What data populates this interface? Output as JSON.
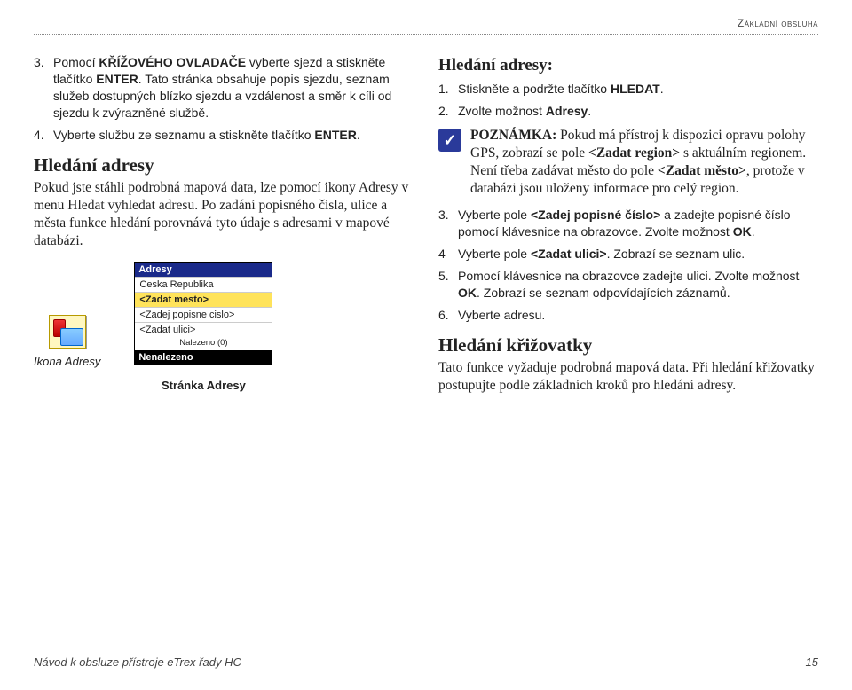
{
  "header": "Základní obsluha",
  "left": {
    "item3_num": "3.",
    "item3_txt": "Pomocí <b>KŘÍŽOVÉHO OVLADAČE</b> vyberte sjezd a stiskněte tlačítko <b>ENTER</b>. Tato stránka obsahuje popis sjezdu, seznam služeb dostupných blízko sjezdu a vzdálenost a směr k cíli od sjezdu k zvýrazněné službě.",
    "item4_num": "4.",
    "item4_txt": "Vyberte službu ze seznamu a stiskněte tlačítko <b>ENTER</b>.",
    "section_title": "Hledání adresy",
    "section_body": "Pokud jste stáhli podrobná mapová data, lze pomocí ikony Adresy v menu Hledat vyhledat adresu. Po zadání popisného čísla, ulice a města funkce hledání porovnává tyto údaje s adresami v mapové databázi.",
    "icon_caption": "Ikona Adresy",
    "screen": {
      "title": "Adresy",
      "r1": "Ceska Republika",
      "r2": "<Zadat mesto>",
      "r3": "<Zadej popisne cislo>",
      "r4": "<Zadat ulici>",
      "tiny": "Nalezeno (0)",
      "result": "Nenalezeno"
    },
    "page_caption": "Stránka Adresy"
  },
  "right": {
    "proc_title": "Hledání adresy:",
    "s1_num": "1.",
    "s1_txt": "Stiskněte a podržte tlačítko <b>HLEDAT</b>.",
    "s2_num": "2.",
    "s2_txt": "Zvolte možnost <b>Adresy</b>.",
    "note_glyph": "✓",
    "note": "<b>POZNÁMKA:</b> Pokud má přístroj k dispozici opravu polohy GPS, zobrazí se pole <b>&lt;Zadat region&gt;</b> s aktuálním regionem. Není třeba zadávat město do pole <b>&lt;Zadat město&gt;</b>, protože v databázi jsou uloženy informace pro celý region.",
    "s3_num": "3.",
    "s3_txt": "Vyberte pole <b>&lt;Zadej popisné číslo&gt;</b> a zadejte popisné číslo pomocí klávesnice na obrazovce. Zvolte možnost <b>OK</b>.",
    "s4_num": "4",
    "s4_txt": "Vyberte pole <b>&lt;Zadat ulici&gt;</b>. Zobrazí se seznam ulic.",
    "s5_num": "5.",
    "s5_txt": "Pomocí klávesnice na obrazovce zadejte ulici. Zvolte možnost <b>OK</b>. Zobrazí se seznam odpovídajících záznamů.",
    "s6_num": "6.",
    "s6_txt": "Vyberte adresu.",
    "sec2_title": "Hledání křižovatky",
    "sec2_body": "Tato funkce vyžaduje podrobná mapová data. Při hledání křižovatky postupujte podle základních kroků pro hledání adresy."
  },
  "footer": {
    "left": "Návod k obsluze přístroje eTrex řady HC",
    "right": "15"
  }
}
